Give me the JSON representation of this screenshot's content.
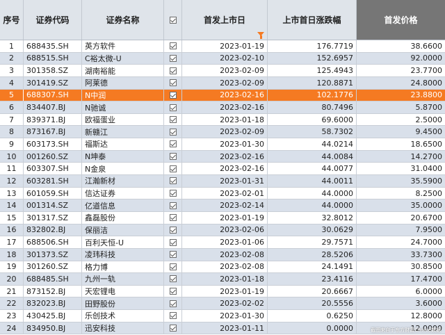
{
  "headers": [
    "序号",
    "证券代码",
    "证券名称",
    "☑",
    "首发上市日",
    "上市首日涨跌幅",
    "首发价格"
  ],
  "rows": [
    [
      "1",
      "688435.SH",
      "英方软件",
      "2023-01-19",
      "176.7719",
      "38.6600"
    ],
    [
      "2",
      "688515.SH",
      "C裕太微-U",
      "2023-02-10",
      "152.6957",
      "92.0000"
    ],
    [
      "3",
      "301358.SZ",
      "湖南裕能",
      "2023-02-09",
      "125.4943",
      "23.7700"
    ],
    [
      "4",
      "301419.SZ",
      "阿莱德",
      "2023-02-09",
      "120.8871",
      "24.8000"
    ],
    [
      "5",
      "688307.SH",
      "N中润",
      "2023-02-16",
      "102.1776",
      "23.8800"
    ],
    [
      "6",
      "834407.BJ",
      "N驰诚",
      "2023-02-16",
      "80.7496",
      "5.8700"
    ],
    [
      "7",
      "839371.BJ",
      "欧福蛋业",
      "2023-01-18",
      "69.6000",
      "2.5000"
    ],
    [
      "8",
      "873167.BJ",
      "新赣江",
      "2023-02-09",
      "58.7302",
      "9.4500"
    ],
    [
      "9",
      "603173.SH",
      "福斯达",
      "2023-01-30",
      "44.0214",
      "18.6500"
    ],
    [
      "10",
      "001260.SZ",
      "N坤泰",
      "2023-02-16",
      "44.0084",
      "14.2700"
    ],
    [
      "11",
      "603307.SH",
      "N金泉",
      "2023-02-16",
      "44.0077",
      "31.0400"
    ],
    [
      "12",
      "603281.SH",
      "江瀚新材",
      "2023-01-31",
      "44.0011",
      "35.5900"
    ],
    [
      "13",
      "601059.SH",
      "信达证券",
      "2023-02-01",
      "44.0000",
      "8.2500"
    ],
    [
      "14",
      "001314.SZ",
      "亿道信息",
      "2023-02-14",
      "44.0000",
      "35.0000"
    ],
    [
      "15",
      "301317.SZ",
      "鑫磊股份",
      "2023-01-19",
      "32.8012",
      "20.6700"
    ],
    [
      "16",
      "832802.BJ",
      "保丽洁",
      "2023-02-06",
      "30.0629",
      "7.9500"
    ],
    [
      "17",
      "688506.SH",
      "百利天恒-U",
      "2023-01-06",
      "29.7571",
      "24.7000"
    ],
    [
      "18",
      "301373.SZ",
      "凌玮科技",
      "2023-02-08",
      "28.5206",
      "33.7300"
    ],
    [
      "19",
      "301260.SZ",
      "格力博",
      "2023-02-08",
      "24.1491",
      "30.8500"
    ],
    [
      "20",
      "688485.SH",
      "九州一轨",
      "2023-01-18",
      "23.4116",
      "17.4700"
    ],
    [
      "21",
      "873152.BJ",
      "天宏锂电",
      "2023-01-19",
      "20.6667",
      "6.0000"
    ],
    [
      "22",
      "832023.BJ",
      "田野股份",
      "2023-02-02",
      "20.5556",
      "3.6000"
    ],
    [
      "23",
      "430425.BJ",
      "乐创技术",
      "2023-01-30",
      "0.6250",
      "12.8000"
    ],
    [
      "24",
      "834950.BJ",
      "迅安科技",
      "2023-01-11",
      "0.0000",
      "12.0000"
    ]
  ],
  "selected_row": 5,
  "watermark": "截图来自于东方财富Choice数据",
  "colors": {
    "selected": "#f57a22",
    "header": "#dfe4ea",
    "alt_row": "#d9e0ea",
    "sort_header": "#767676"
  },
  "icons": {
    "filter": "filter-icon",
    "checkbox": "checkbox-icon"
  }
}
